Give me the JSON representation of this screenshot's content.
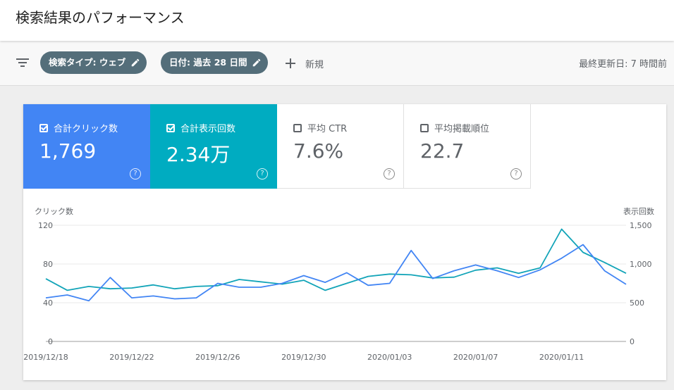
{
  "page": {
    "title": "検索結果のパフォーマンス"
  },
  "toolbar": {
    "filter_icon": "filter-list-icon",
    "chips": [
      {
        "label": "検索タイプ: ウェブ",
        "icon": "edit-pencil-icon"
      },
      {
        "label": "日付: 過去 28 日間",
        "icon": "edit-pencil-icon"
      }
    ],
    "new_label": "新規",
    "last_updated": "最終更新日: 7 時間前"
  },
  "metrics": [
    {
      "label": "合計クリック数",
      "value": "1,769",
      "checked": true,
      "color": "#4285f4"
    },
    {
      "label": "合計表示回数",
      "value": "2.34万",
      "checked": true,
      "color": "#00acc1"
    },
    {
      "label": "平均 CTR",
      "value": "7.6%",
      "checked": false
    },
    {
      "label": "平均掲載順位",
      "value": "22.7",
      "checked": false
    }
  ],
  "help_glyph": "?",
  "chart_data": {
    "type": "line",
    "y_left_label": "クリック数",
    "y_right_label": "表示回数",
    "y_left_ticks": [
      "120",
      "80",
      "40",
      "0"
    ],
    "y_right_ticks": [
      "1,500",
      "1,000",
      "500",
      "0"
    ],
    "y_left_lim": [
      0,
      120
    ],
    "y_right_lim": [
      0,
      1500
    ],
    "x_tick_labels": [
      "2019/12/18",
      "2019/12/22",
      "2019/12/26",
      "2019/12/30",
      "2020/01/03",
      "2020/01/07",
      "2020/01/11"
    ],
    "x_tick_indices": [
      0,
      4,
      8,
      12,
      16,
      20,
      24
    ],
    "grid": true,
    "series": [
      {
        "axis": "left",
        "color": "#4285f4",
        "values": [
          45,
          48,
          42,
          66,
          45,
          47,
          44,
          45,
          60,
          56,
          56,
          60,
          68,
          61,
          71,
          58,
          60,
          94,
          65,
          73,
          79,
          73,
          66,
          74,
          86,
          100,
          73,
          59
        ]
      },
      {
        "axis": "right",
        "color": "#12a4b8",
        "values": [
          810,
          660,
          710,
          680,
          690,
          730,
          680,
          710,
          720,
          800,
          770,
          740,
          790,
          660,
          750,
          840,
          870,
          860,
          820,
          830,
          920,
          950,
          880,
          950,
          1450,
          1150,
          1020,
          880
        ]
      }
    ]
  }
}
